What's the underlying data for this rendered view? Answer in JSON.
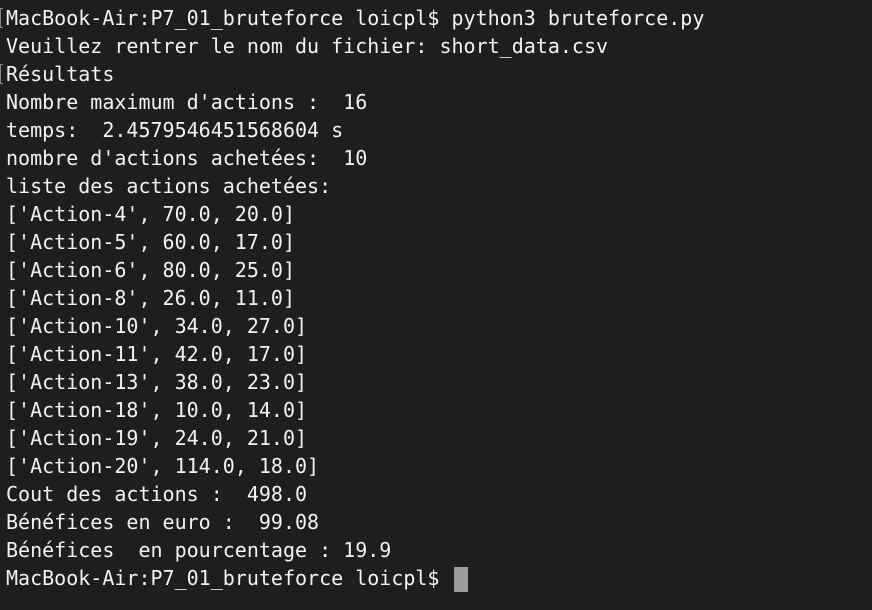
{
  "terminal": {
    "lines": [
      "MacBook-Air:P7_01_bruteforce loicpl$ python3 bruteforce.py",
      "Veuillez rentrer le nom du fichier: short_data.csv",
      "Résultats",
      "Nombre maximum d'actions :  16",
      "temps:  2.4579546451568604 s",
      "nombre d'actions achetées:  10",
      "liste des actions achetées:",
      "['Action-4', 70.0, 20.0]",
      "['Action-5', 60.0, 17.0]",
      "['Action-6', 80.0, 25.0]",
      "['Action-8', 26.0, 11.0]",
      "['Action-10', 34.0, 27.0]",
      "['Action-11', 42.0, 17.0]",
      "['Action-13', 38.0, 23.0]",
      "['Action-18', 10.0, 14.0]",
      "['Action-19', 24.0, 21.0]",
      "['Action-20', 114.0, 18.0]",
      "Cout des actions :  498.0",
      "Bénéfices en euro :  99.08",
      "Bénéfices  en pourcentage : 19.9"
    ],
    "prompt": "MacBook-Air:P7_01_bruteforce loicpl$ "
  }
}
